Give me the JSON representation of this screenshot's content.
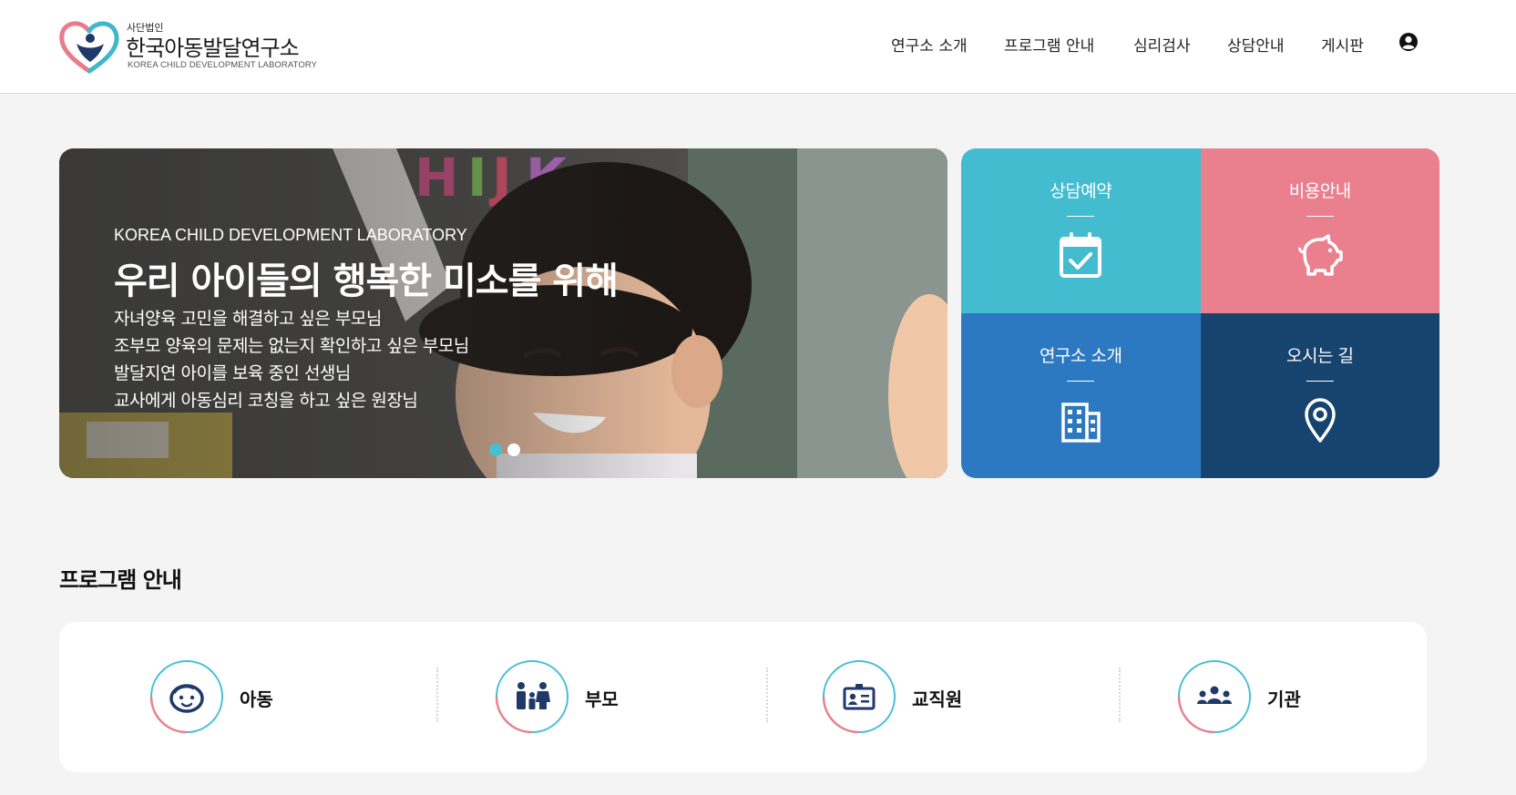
{
  "header": {
    "logo": {
      "sub": "사단법인",
      "title": "한국아동발달연구소",
      "english": "KOREA CHILD DEVELOPMENT LABORATORY"
    },
    "nav": [
      {
        "label": "연구소 소개"
      },
      {
        "label": "프로그램 안내"
      },
      {
        "label": "심리검사"
      },
      {
        "label": "상담안내"
      },
      {
        "label": "게시판"
      }
    ],
    "user_icon": "user-circle-icon"
  },
  "hero": {
    "eyebrow": "KOREA CHILD DEVELOPMENT LABORATORY",
    "title": "우리 아이들의 행복한 미소를 위해",
    "lines": [
      "자녀양육 고민을 해결하고 싶은 부모님",
      "조부모 양육의 문제는 없는지 확인하고 싶은 부모님",
      "발달지연 아이를 보육 중인 선생님",
      "교사에게 아동심리 코칭을 하고 싶은 원장님"
    ],
    "slides_total": 2,
    "active_slide": 1,
    "dot_active_color": "#45c0d2",
    "dot_inactive_color": "#ffffff"
  },
  "tiles": [
    {
      "label": "상담예약",
      "icon": "calendar-check-icon",
      "color": "#43bccf"
    },
    {
      "label": "비용안내",
      "icon": "piggy-bank-icon",
      "color": "#ea7f8e"
    },
    {
      "label": "연구소 소개",
      "icon": "building-icon",
      "color": "#2c79c1"
    },
    {
      "label": "오시는 길",
      "icon": "map-pin-icon",
      "color": "#17436f"
    }
  ],
  "programs": {
    "title": "프로그램 안내",
    "items": [
      {
        "label": "아동",
        "icon": "child-face-icon"
      },
      {
        "label": "부모",
        "icon": "family-icon"
      },
      {
        "label": "교직원",
        "icon": "id-card-icon"
      },
      {
        "label": "기관",
        "icon": "group-icon"
      }
    ]
  },
  "colors": {
    "navy": "#1f3a68",
    "teal": "#45c0d2",
    "pink": "#ea7f8e",
    "page_bg": "#f4f4f4"
  }
}
